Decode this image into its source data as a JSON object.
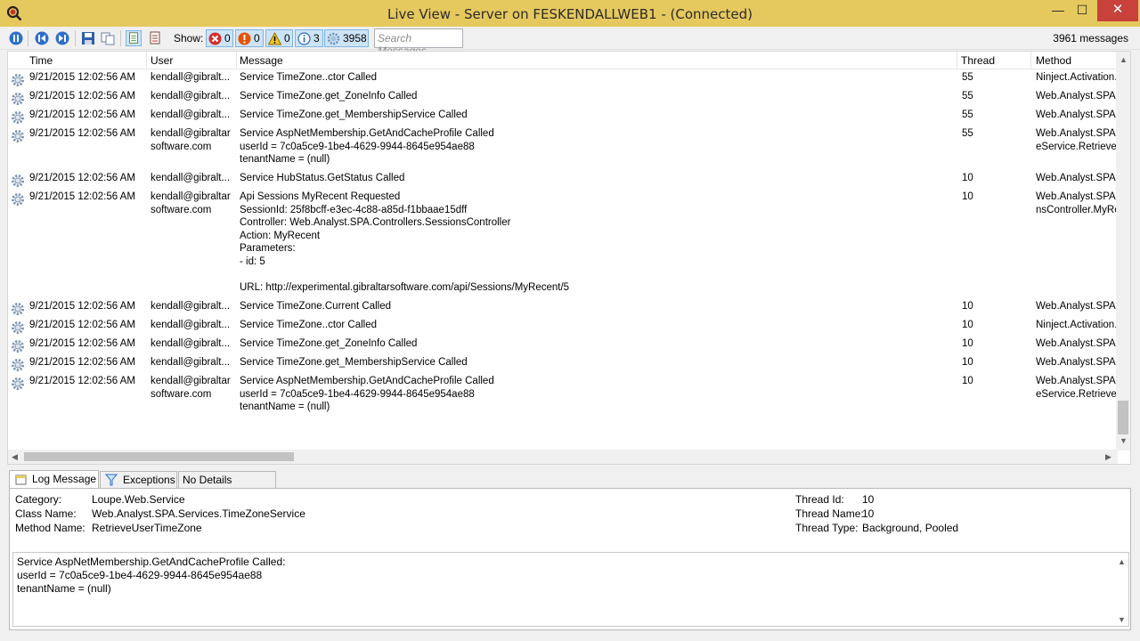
{
  "window": {
    "title": "Live View - Server on FESKENDALLWEB1 - (Connected)",
    "min_glyph": "—",
    "max_glyph": "☐",
    "close_glyph": "✕",
    "accent": "#e6c95e"
  },
  "toolbar": {
    "show_label": "Show:",
    "filters": [
      {
        "icon": "error-icon",
        "count": "0"
      },
      {
        "icon": "critical-icon",
        "count": "0"
      },
      {
        "icon": "warning-icon",
        "count": "0"
      },
      {
        "icon": "info-icon",
        "count": "3"
      },
      {
        "icon": "verbose-gear-icon",
        "count": "3958"
      }
    ],
    "search_placeholder": "Search Messages",
    "message_count": "3961 messages"
  },
  "grid": {
    "columns": [
      "Time",
      "User",
      "Message",
      "Thread",
      "Method"
    ],
    "rows": [
      {
        "time": "9/21/2015 12:02:56 AM",
        "user": "kendall@gibralt...",
        "message": "Service TimeZone..ctor Called",
        "thread": "55",
        "method": "Ninject.Activation."
      },
      {
        "time": "9/21/2015 12:02:56 AM",
        "user": "kendall@gibralt...",
        "message": "Service TimeZone.get_ZoneInfo Called",
        "thread": "55",
        "method": "Web.Analyst.SPA.S"
      },
      {
        "time": "9/21/2015 12:02:56 AM",
        "user": "kendall@gibralt...",
        "message": "Service TimeZone.get_MembershipService Called",
        "thread": "55",
        "method": "Web.Analyst.SPA.S"
      },
      {
        "time": "9/21/2015 12:02:56 AM",
        "user": "kendall@gibraltar\nsoftware.com",
        "message": "Service AspNetMembership.GetAndCacheProfile Called\nuserId = 7c0a5ce9-1be4-4629-9944-8645e954ae88\ntenantName = (null)",
        "thread": "55",
        "method": "Web.Analyst.SPA.S\neService.RetrieveU"
      },
      {
        "time": "9/21/2015 12:02:56 AM",
        "user": "kendall@gibralt...",
        "message": "Service HubStatus.GetStatus Called",
        "thread": "10",
        "method": "Web.Analyst.SPA.H"
      },
      {
        "time": "9/21/2015 12:02:56 AM",
        "user": "kendall@gibraltar\nsoftware.com",
        "message": "Api Sessions MyRecent Requested\nSessionId: 25f8bcff-e3ec-4c88-a85d-f1bbaae15dff\nController: Web.Analyst.SPA.Controllers.SessionsController\nAction: MyRecent\nParameters:\n- id: 5\n\nURL: http://experimental.gibraltarsoftware.com/api/Sessions/MyRecent/5",
        "thread": "10",
        "method": "Web.Analyst.SPA.C\nnsController.MyRe"
      },
      {
        "time": "9/21/2015 12:02:56 AM",
        "user": "kendall@gibralt...",
        "message": "Service TimeZone.Current Called",
        "thread": "10",
        "method": "Web.Analyst.SPA.C"
      },
      {
        "time": "9/21/2015 12:02:56 AM",
        "user": "kendall@gibralt...",
        "message": "Service TimeZone..ctor Called",
        "thread": "10",
        "method": "Ninject.Activation."
      },
      {
        "time": "9/21/2015 12:02:56 AM",
        "user": "kendall@gibralt...",
        "message": "Service TimeZone.get_ZoneInfo Called",
        "thread": "10",
        "method": "Web.Analyst.SPA.C"
      },
      {
        "time": "9/21/2015 12:02:56 AM",
        "user": "kendall@gibralt...",
        "message": "Service TimeZone.get_MembershipService Called",
        "thread": "10",
        "method": "Web.Analyst.SPA.S"
      },
      {
        "time": "9/21/2015 12:02:56 AM",
        "user": "kendall@gibraltar\nsoftware.com",
        "message": "Service AspNetMembership.GetAndCacheProfile Called\nuserId = 7c0a5ce9-1be4-4629-9944-8645e954ae88\ntenantName = (null)",
        "thread": "10",
        "method": "Web.Analyst.SPA.S\neService.RetrieveU"
      }
    ]
  },
  "details": {
    "tabs": [
      "Log Message",
      "Exceptions",
      "No Details Available"
    ],
    "category_label": "Category:",
    "category": "Loupe.Web.Service",
    "class_label": "Class Name:",
    "class_name": "Web.Analyst.SPA.Services.TimeZoneService",
    "method_label": "Method Name:",
    "method_name": "RetrieveUserTimeZone",
    "thread_id_label": "Thread Id:",
    "thread_id": "10",
    "thread_name_label": "Thread Name:",
    "thread_name": "10",
    "thread_type_label": "Thread Type:",
    "thread_type": "Background, Pooled",
    "message_lines": [
      "Service AspNetMembership.GetAndCacheProfile Called:",
      "userId = 7c0a5ce9-1be4-4629-9944-8645e954ae88",
      "tenantName = (null)"
    ]
  }
}
